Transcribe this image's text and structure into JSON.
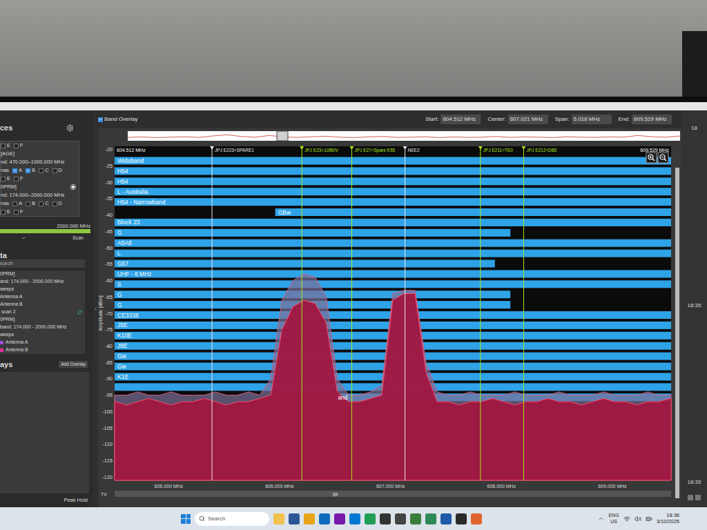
{
  "header": {
    "band_overlay": {
      "label": "Band Overlay",
      "checked": true
    },
    "fields": [
      {
        "label": "Start:",
        "value": "604.512 MHz"
      },
      {
        "label": "Center:",
        "value": "607.021 MHz"
      },
      {
        "label": "Span:",
        "value": "5.018 MHz"
      },
      {
        "label": "End:",
        "value": "609.529 MHz"
      }
    ]
  },
  "sidebar": {
    "devices_heading": "ces",
    "device_rows": [
      {
        "kind": "checks",
        "label": "",
        "checks": [
          {
            "label": "E",
            "checked": false
          },
          {
            "label": "F",
            "checked": false
          }
        ]
      },
      {
        "kind": "text",
        "label": "[AGE]"
      },
      {
        "kind": "text",
        "label": "nd: 470.000–1000.000 MHz"
      },
      {
        "kind": "checks",
        "label": "nas",
        "checks": [
          {
            "label": "A",
            "checked": true
          },
          {
            "label": "B",
            "checked": true
          },
          {
            "label": "C",
            "checked": false
          },
          {
            "label": "D",
            "checked": false
          }
        ]
      },
      {
        "kind": "checks",
        "label": "",
        "checks": [
          {
            "label": "E",
            "checked": false
          },
          {
            "label": "F",
            "checked": false
          }
        ]
      },
      {
        "kind": "radio",
        "label": "0PRM]",
        "selected": true
      },
      {
        "kind": "text",
        "label": "nd: 174.000–2000.000 MHz"
      },
      {
        "kind": "checks",
        "label": "nas",
        "checks": [
          {
            "label": "A",
            "checked": false
          },
          {
            "label": "B",
            "checked": false
          },
          {
            "label": "C",
            "checked": false
          },
          {
            "label": "D",
            "checked": false
          }
        ]
      },
      {
        "kind": "checks",
        "label": "",
        "checks": [
          {
            "label": "E",
            "checked": false
          },
          {
            "label": "F",
            "checked": false
          }
        ]
      }
    ],
    "range_label": "2000.000 MHz",
    "range_level": 1,
    "scan_button": "Scan",
    "data_heading": "ta",
    "search_placeholder": "earch",
    "data_items": [
      {
        "kind": "text",
        "label": "0PRM]"
      },
      {
        "kind": "text",
        "label": "and: 174.000 - 2000.000 MHz"
      },
      {
        "kind": "text",
        "label": "weeps"
      },
      {
        "kind": "text",
        "label": "Antenna A"
      },
      {
        "kind": "text",
        "label": "Antenna B"
      },
      {
        "kind": "scan",
        "label": " scan 2"
      },
      {
        "kind": "text",
        "label": "0PRM]"
      },
      {
        "kind": "text",
        "label": "band: 174.000 - 2000.000 MHz"
      },
      {
        "kind": "text",
        "label": "weeps"
      },
      {
        "kind": "antenna",
        "label": "Antenna A",
        "color": "#9b4fd6"
      },
      {
        "kind": "antenna",
        "label": "Antenna B",
        "color": "#e0309a"
      }
    ],
    "overlays_heading": "ays",
    "add_overlay_button": "Add Overlay",
    "peak_hold": "Peak Hold"
  },
  "chart": {
    "y_label": "Amplitude [dBm]",
    "y_min": -121,
    "y_max": -19,
    "min_mhz": 604.512,
    "max_mhz": 609.529,
    "y_ticks": [
      "-20",
      "-25",
      "-30",
      "-35",
      "-40",
      "-45",
      "-50",
      "-55",
      "-60",
      "-65",
      "-70",
      "-75",
      "-80",
      "-85",
      "-90",
      "-95",
      "-100",
      "-105",
      "-110",
      "-115",
      "-120"
    ],
    "x_ticks": [
      {
        "label": "605.000 MHz",
        "mhz": 605
      },
      {
        "label": "606.000 MHz",
        "mhz": 606
      },
      {
        "label": "607.000 MHz",
        "mhz": 607
      },
      {
        "label": "608.000 MHz",
        "mhz": 608
      },
      {
        "label": "609.000 MHz",
        "mhz": 609
      }
    ],
    "corner_start": "604.512 MHz",
    "corner_end": "609.529 MHz",
    "tv_label": "TV",
    "tv_channels": [
      {
        "label": "39",
        "mhz": 606.5
      }
    ],
    "markers": [
      {
        "label": "JPJ E223=SPARE1",
        "mhz": 605.39,
        "color": "#e8e8e8"
      },
      {
        "label": "JPJ E23=JJ/B0V",
        "mhz": 606.2,
        "color": "#a8e61c"
      },
      {
        "label": "JPJ E27=Spare K55",
        "mhz": 606.65,
        "color": "#a8e61c"
      },
      {
        "label": "NEE2",
        "mhz": 607.13,
        "color": "#e8e8e8"
      },
      {
        "label": "JPJ E211=TE0",
        "mhz": 607.81,
        "color": "#a8e61c"
      },
      {
        "label": "JPJ E212=D8E",
        "mhz": 608.2,
        "color": "#a8e61c"
      }
    ],
    "bands": [
      {
        "label": "Wideband",
        "start": 604.512,
        "end": 609.529
      },
      {
        "label": "H54",
        "start": 604.512,
        "end": 609.529
      },
      {
        "label": "H54",
        "start": 604.512,
        "end": 609.529
      },
      {
        "label": "L - Australia",
        "start": 604.512,
        "end": 609.529
      },
      {
        "label": "H54 - Narrowband",
        "start": 604.512,
        "end": 609.529
      },
      {
        "label": "GBw",
        "start": 605.96,
        "end": 609.529
      },
      {
        "label": "Block 23",
        "start": 604.512,
        "end": 609.529
      },
      {
        "label": "G",
        "start": 604.512,
        "end": 608.08
      },
      {
        "label": "A5A8",
        "start": 604.512,
        "end": 609.529
      },
      {
        "label": "L",
        "start": 604.512,
        "end": 609.529
      },
      {
        "label": "G57",
        "start": 604.512,
        "end": 607.94
      },
      {
        "label": "UHF - 8 MHz",
        "start": 604.512,
        "end": 609.529
      },
      {
        "label": "S",
        "start": 604.512,
        "end": 609.529
      },
      {
        "label": "G",
        "start": 604.512,
        "end": 608.08
      },
      {
        "label": "G",
        "start": 604.512,
        "end": 608.08
      },
      {
        "label": "CE3338",
        "start": 604.512,
        "end": 609.529
      },
      {
        "label": "J5E",
        "start": 604.512,
        "end": 609.529
      },
      {
        "label": "K10E",
        "start": 604.512,
        "end": 609.529
      },
      {
        "label": "J8E",
        "start": 604.512,
        "end": 609.529
      },
      {
        "label": "Gw",
        "start": 604.512,
        "end": 609.529
      },
      {
        "label": "Gw",
        "start": 604.512,
        "end": 609.529
      },
      {
        "label": "K1E",
        "start": 604.512,
        "end": 609.529
      },
      {
        "label": "",
        "start": 604.512,
        "end": 609.529
      },
      {
        "label": "and",
        "start": 606.5,
        "end": 609.529
      }
    ],
    "x_start": 604.52,
    "x_step": 0.1,
    "series": [
      {
        "name": "peak_hold",
        "values": [
          -95,
          -95,
          -94,
          -95,
          -95,
          -94,
          -95,
          -95,
          -95,
          -94,
          -95,
          -95,
          -94,
          -95,
          -90,
          -66,
          -60,
          -58,
          -59,
          -65,
          -90,
          -95,
          -95,
          -94,
          -92,
          -64,
          -63,
          -63,
          -85,
          -94,
          -95,
          -95,
          -94,
          -95,
          -95,
          -95,
          -94,
          -95,
          -95,
          -95,
          -94,
          -95,
          -95,
          -95,
          -94,
          -95,
          -95,
          -95,
          -94,
          -95,
          -95
        ]
      },
      {
        "name": "live",
        "values": [
          -97,
          -98,
          -97,
          -96,
          -97,
          -98,
          -97,
          -97,
          -96,
          -97,
          -98,
          -97,
          -97,
          -96,
          -95,
          -75,
          -68,
          -66,
          -67,
          -73,
          -94,
          -97,
          -97,
          -96,
          -95,
          -66,
          -64,
          -64,
          -88,
          -97,
          -97,
          -98,
          -97,
          -97,
          -96,
          -97,
          -98,
          -97,
          -97,
          -96,
          -97,
          -97,
          -98,
          -97,
          -96,
          -97,
          -97,
          -98,
          -97,
          -97,
          -96
        ]
      }
    ],
    "overview": {
      "values": [
        -96,
        -94,
        -97,
        -95,
        -93,
        -96,
        -90,
        -85,
        -92,
        -95,
        -88,
        -94,
        -96,
        -93,
        -91,
        -95,
        -97,
        -94,
        -92,
        -96,
        -95,
        -93,
        -97,
        -94,
        -96,
        -95,
        -92,
        -96,
        -94,
        -95,
        -97,
        -93,
        -95,
        -96,
        -94,
        -95,
        -88,
        -93,
        -95,
        -90
      ],
      "view_start": 0.27,
      "view_end": 0.29
    },
    "scrollbar": {
      "level": 0.95
    }
  },
  "right_panel": {
    "labels": [
      "18",
      "18:35",
      "18:35"
    ]
  },
  "taskbar": {
    "search_placeholder": "Search",
    "apps": [
      {
        "color": "#f2c14e"
      },
      {
        "color": "#2b5797"
      },
      {
        "color": "#e8a317"
      },
      {
        "color": "#0f6cbd"
      },
      {
        "color": "#7719aa"
      },
      {
        "color": "#0078d4"
      },
      {
        "color": "#1f9d55"
      },
      {
        "color": "#333333"
      },
      {
        "color": "#444444"
      },
      {
        "color": "#3a7f3a"
      },
      {
        "color": "#2d8a57"
      },
      {
        "color": "#1e5aa8"
      },
      {
        "color": "#2a2a2a"
      },
      {
        "color": "#e0632e"
      }
    ],
    "lang": [
      "ENG",
      "US"
    ],
    "time": "18:36",
    "date": "3/10/2025"
  }
}
